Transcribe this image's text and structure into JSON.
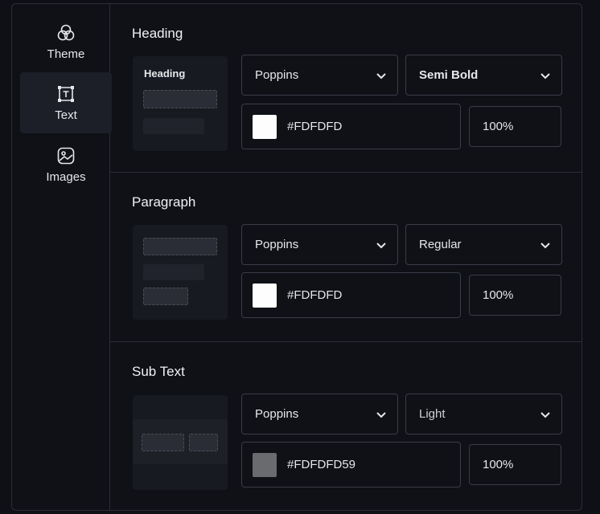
{
  "sidebar": {
    "items": [
      {
        "label": "Theme",
        "icon": "theme-icon"
      },
      {
        "label": "Text",
        "icon": "text-icon"
      },
      {
        "label": "Images",
        "icon": "image-icon"
      }
    ],
    "active_index": 1
  },
  "sections": [
    {
      "title": "Heading",
      "preview_title": "Heading",
      "font": "Poppins",
      "weight": "Semi Bold",
      "color_hex": "#FDFDFD",
      "swatch_color": "#fdfdfd",
      "opacity": "100%"
    },
    {
      "title": "Paragraph",
      "font": "Poppins",
      "weight": "Regular",
      "color_hex": "#FDFDFD",
      "swatch_color": "#fdfdfd",
      "opacity": "100%"
    },
    {
      "title": "Sub Text",
      "font": "Poppins",
      "weight": "Light",
      "color_hex": "#FDFDFD59",
      "swatch_color": "#6a6b6e",
      "opacity": "100%"
    }
  ]
}
